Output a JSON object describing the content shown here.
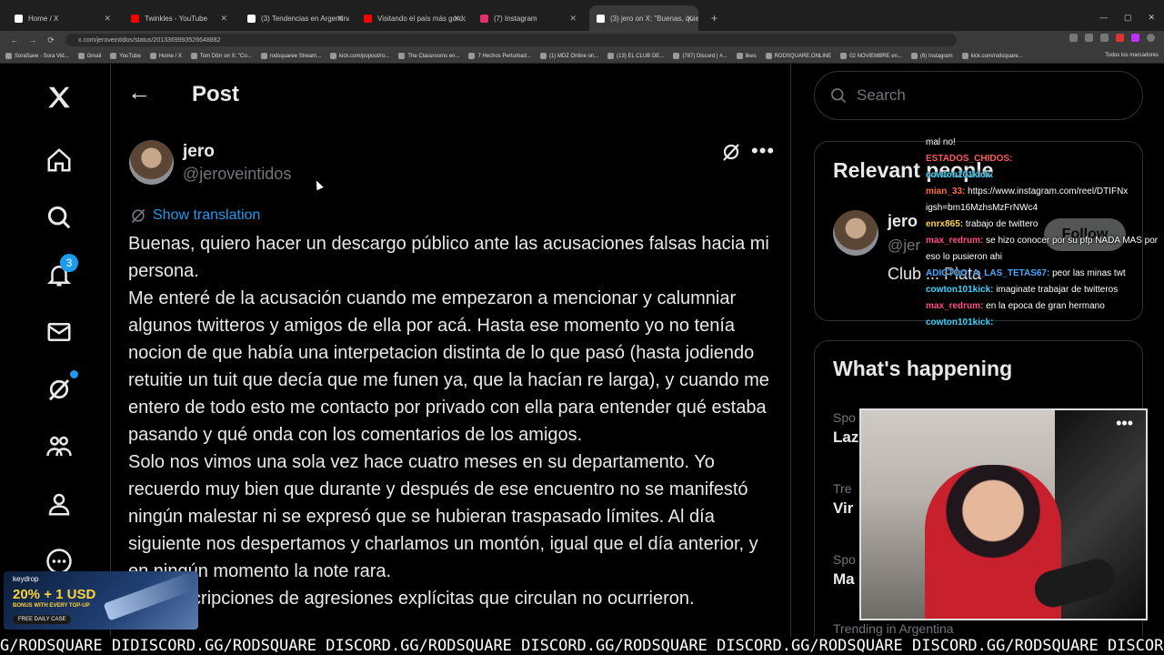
{
  "browser": {
    "tabs": [
      {
        "label": "Home / X",
        "color": "#ffffff"
      },
      {
        "label": "Twinkles - YouTube",
        "color": "#ff0000"
      },
      {
        "label": "(3) Tendencias en Argentina (0",
        "color": "#ffffff"
      },
      {
        "label": "Visitando el país más gordo y ...",
        "color": "#ff0000"
      },
      {
        "label": "(7) Instagram",
        "color": "#e1306c"
      },
      {
        "label": "(3) jero on X: \"Buenas, quiero h",
        "color": "#ffffff"
      }
    ],
    "url": "x.com/jeroveintidos/status/2013369993526648882",
    "bookmarks": [
      "SoraSave - Sora Vid...",
      "Gmail",
      "YouTube",
      "Home / X",
      "Tom Dörr on X: \"Co...",
      "rodsquaree Stream...",
      "kick.com/popout/ro...",
      "The Classrooms en...",
      "7 Hechos Perturbad...",
      "(1) MDZ Online on...",
      "(13) EL CLUB DE...",
      "(787) Discord | #...",
      "likes",
      "RODSQUARE.ONLINE",
      "02 NOVIEMBRE en...",
      "(6) Instagram",
      "kick.com/rodsquare..."
    ],
    "bookmarks_right": "Todos los marcadores"
  },
  "nav": {
    "notifications_count": "3",
    "accent": "#1d9bf0"
  },
  "post": {
    "header_title": "Post",
    "display_name": "jero",
    "handle": "@jeroveintidos",
    "show_translation": "Show translation",
    "paragraphs": [
      "Buenas, quiero hacer un descargo público ante las acusaciones falsas hacia mi persona.",
      "Me enteré de la acusación cuando me empezaron a mencionar y calumniar algunos twitteros y amigos de ella por acá. Hasta ese momento yo no tenía nocion de que había una interpetacion distinta de lo que pasó (hasta jodiendo retuitie un tuit que decía que me funen ya, que la hacían re larga), y cuando me entero de todo esto me contacto por privado con ella para entender qué estaba pasando y qué onda con los comentarios de los amigos.",
      "Solo nos vimos una sola vez hace cuatro meses en su departamento. Yo recuerdo muy bien que durante y después de ese encuentro no se manifestó ningún malestar ni se expresó que se hubieran traspasado límites. Al día siguiente nos despertamos y charlamos un montón, igual que el día anterior, y en ningún momento la note rara.",
      "Las descripciones de agresiones explícitas que circulan no ocurrieron."
    ]
  },
  "sidebar": {
    "search_placeholder": "Search",
    "relevant_title": "Relevant people",
    "relevant_person": {
      "name": "jero",
      "handle": "@jer",
      "bio": "Club ... Plata",
      "follow_label": "Follow"
    },
    "happening_title": "What's happening",
    "trends": [
      {
        "category": "Spo",
        "name": "Laz"
      },
      {
        "category": "Tre",
        "name": "Vir"
      },
      {
        "category": "Spo",
        "name": "Ma"
      }
    ],
    "trending_footer": "Trending in Argentina"
  },
  "chat": [
    {
      "user": "",
      "text": "mal no!",
      "cls": "u1"
    },
    {
      "user": "ESTADOS_CHIDOS:",
      "text": "",
      "cls": "u1"
    },
    {
      "user": "cowton101kick:",
      "text": "",
      "cls": "u2"
    },
    {
      "user": "",
      "text": "",
      "cls": "u1"
    },
    {
      "user": "mian_33:",
      "text": "https://www.instagram.com/reel/DTIFNx igsh=bm16MzhsMzFrNWc4",
      "cls": "u3"
    },
    {
      "user": "enrx865:",
      "text": "trabajo de twittero",
      "cls": "u4"
    },
    {
      "user": "max_redrum:",
      "text": "se hizo conocer por su pfp NADA MAS por eso lo pusieron ahi",
      "cls": "u5"
    },
    {
      "user": "ADICTOO_A_LAS_TETAS67:",
      "text": "peor las minas twt",
      "cls": "u6"
    },
    {
      "user": "cowton101kick:",
      "text": "imaginate trabajar de twitteros",
      "cls": "u2"
    },
    {
      "user": "max_redrum:",
      "text": "en la epoca de gran hermano",
      "cls": "u5"
    },
    {
      "user": "cowton101kick:",
      "text": "",
      "cls": "u2"
    }
  ],
  "ad": {
    "brand": "keydrop",
    "headline": "20% + 1 USD",
    "sub": "BONUS WITH EVERY TOP-UP",
    "pill": "FREE DAILY CASE"
  },
  "ticker": "G/RODSQUARE DIDISCORD.GG/RODSQUARE DISCORD.GG/RODSQUARE DISCORD.GG/RODSQUARE DISCORD.GG/RODSQUARE DISCORD.GG/RODSQUARE DISCORD.GG"
}
